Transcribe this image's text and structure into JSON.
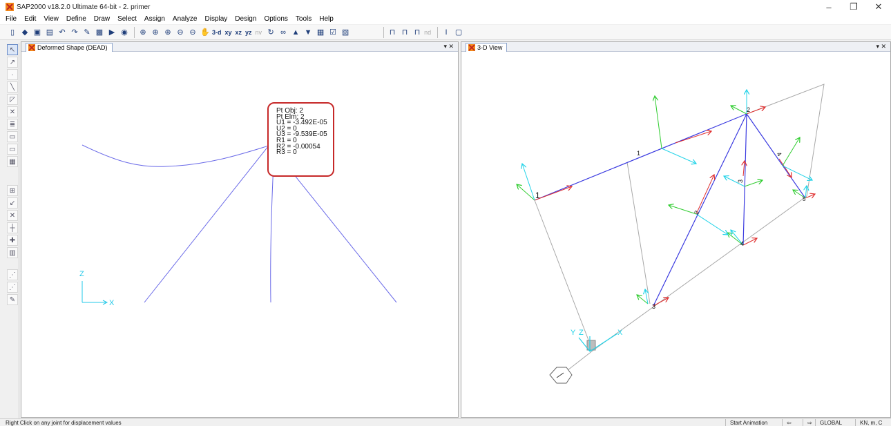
{
  "window": {
    "title": "SAP2000 v18.2.0 Ultimate 64-bit - 2. primer",
    "controls": {
      "minimize": "–",
      "restore": "❐",
      "close": "✕"
    }
  },
  "menu": [
    "File",
    "Edit",
    "View",
    "Define",
    "Draw",
    "Select",
    "Assign",
    "Analyze",
    "Display",
    "Design",
    "Options",
    "Tools",
    "Help"
  ],
  "toolbar": {
    "view_labels": [
      "3-d",
      "xy",
      "xz",
      "yz",
      "nv"
    ],
    "nd_label": "nd"
  },
  "left_pane": {
    "tab_title": "Deformed Shape (DEAD)",
    "controls": "▾ ✕",
    "axis_z": "Z",
    "axis_x": "X",
    "joint_label": "2",
    "info": {
      "lines": [
        "Pt Obj: 2",
        "Pt Elm: 2",
        "U1 = -3.492E-05",
        "U2 =  0",
        "U3 = -9.539E-05",
        "R1 =  0",
        "R2 = -0.00054",
        "R3 =  0"
      ]
    }
  },
  "right_pane": {
    "tab_title": "3-D View",
    "controls": "▾ ✕",
    "joint_labels": [
      "1",
      "2",
      "3",
      "4",
      "5"
    ],
    "frame_labels": [
      "1",
      "2",
      "3",
      "4"
    ],
    "axis_x": "X",
    "axis_y": "Y",
    "axis_z": "Z"
  },
  "status": {
    "message": "Right Click on any joint for displacement values",
    "start_animation": "Start Animation",
    "prev": "⇦",
    "next": "⇨",
    "coord_system": "GLOBAL",
    "units": "KN, m, C"
  },
  "colors": {
    "frame_blue": "#3a3ae0",
    "frame_gray": "#a8a8a8",
    "local_red": "#e03030",
    "local_green": "#2ecc2e",
    "local_cyan": "#22d3e8",
    "highlight": "#c62828"
  }
}
